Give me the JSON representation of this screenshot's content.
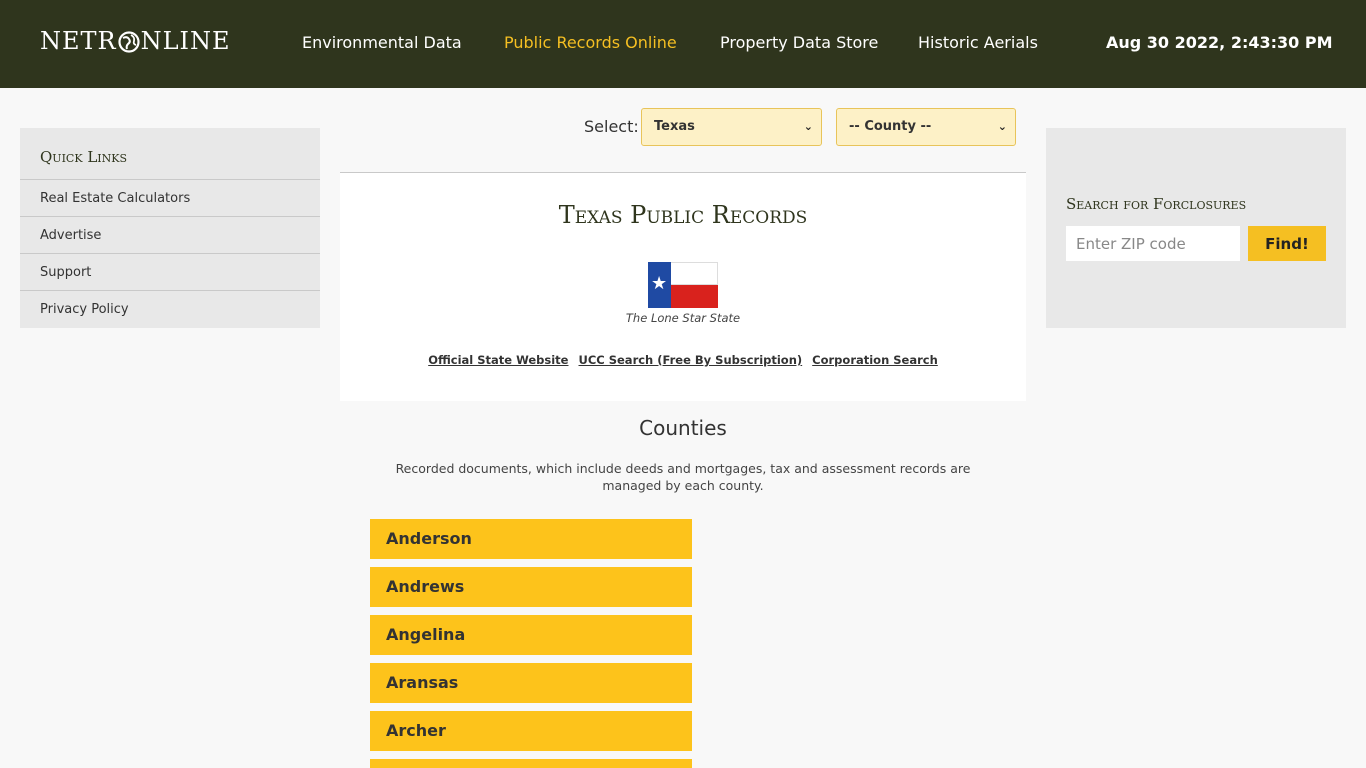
{
  "header": {
    "logo_left": "NETR",
    "logo_right": "NLINE",
    "nav": [
      {
        "label": "Environmental Data",
        "active": false
      },
      {
        "label": "Public Records Online",
        "active": true
      },
      {
        "label": "Property Data Store",
        "active": false
      },
      {
        "label": "Historic Aerials",
        "active": false
      }
    ],
    "datetime": "Aug 30 2022, 2:43:30 PM"
  },
  "colors": {
    "header_bg": "#2f351d",
    "accent": "#f5bf22",
    "county_button": "#fdc31b"
  },
  "quick_links": {
    "title": "Quick Links",
    "items": [
      "Real Estate Calculators",
      "Advertise",
      "Support",
      "Privacy Policy"
    ]
  },
  "foreclosure": {
    "title": "Search for Forclosures",
    "zip_placeholder": "Enter ZIP code",
    "find_label": "Find!"
  },
  "selector": {
    "label": "Select:",
    "state_value": "Texas",
    "county_value": "-- County --"
  },
  "state": {
    "title": "Texas Public Records",
    "nickname": "The Lone Star State",
    "links": [
      "Official State Website",
      "UCC Search (Free By Subscription)",
      "Corporation Search"
    ]
  },
  "counties": {
    "title": "Counties",
    "description": "Recorded documents, which include deeds and mortgages, tax and assessment records are managed by each county.",
    "items": [
      "Anderson",
      "Andrews",
      "Angelina",
      "Aransas",
      "Archer"
    ]
  }
}
